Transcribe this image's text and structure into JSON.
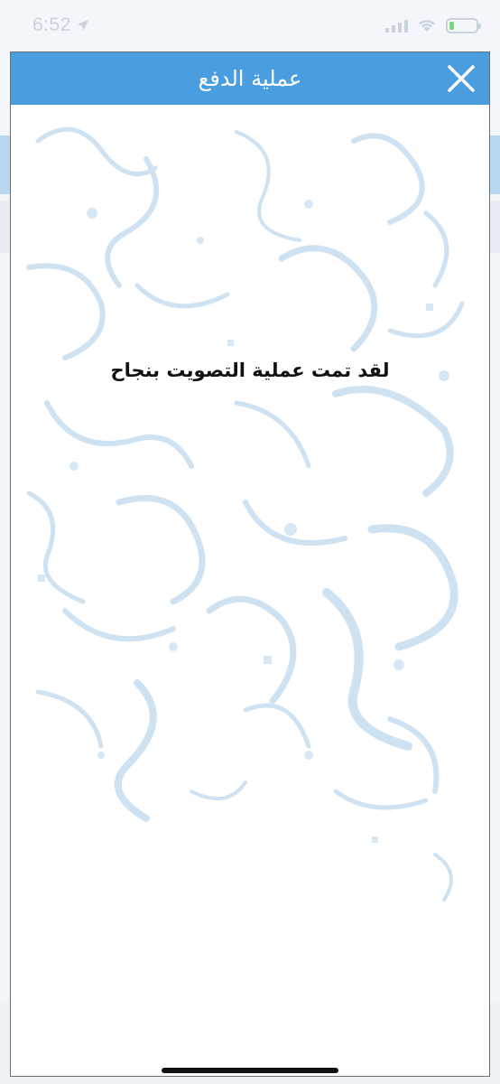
{
  "status_bar": {
    "time": "6:52",
    "colors": {
      "battery_fill": "#7ed67a",
      "icons": "#c9d3dc"
    }
  },
  "modal": {
    "title": "عملية الدفع",
    "close_icon": "close-icon",
    "message": "لقد تمت عملية التصويت بنجاح",
    "header_color": "#4a9ee0"
  }
}
